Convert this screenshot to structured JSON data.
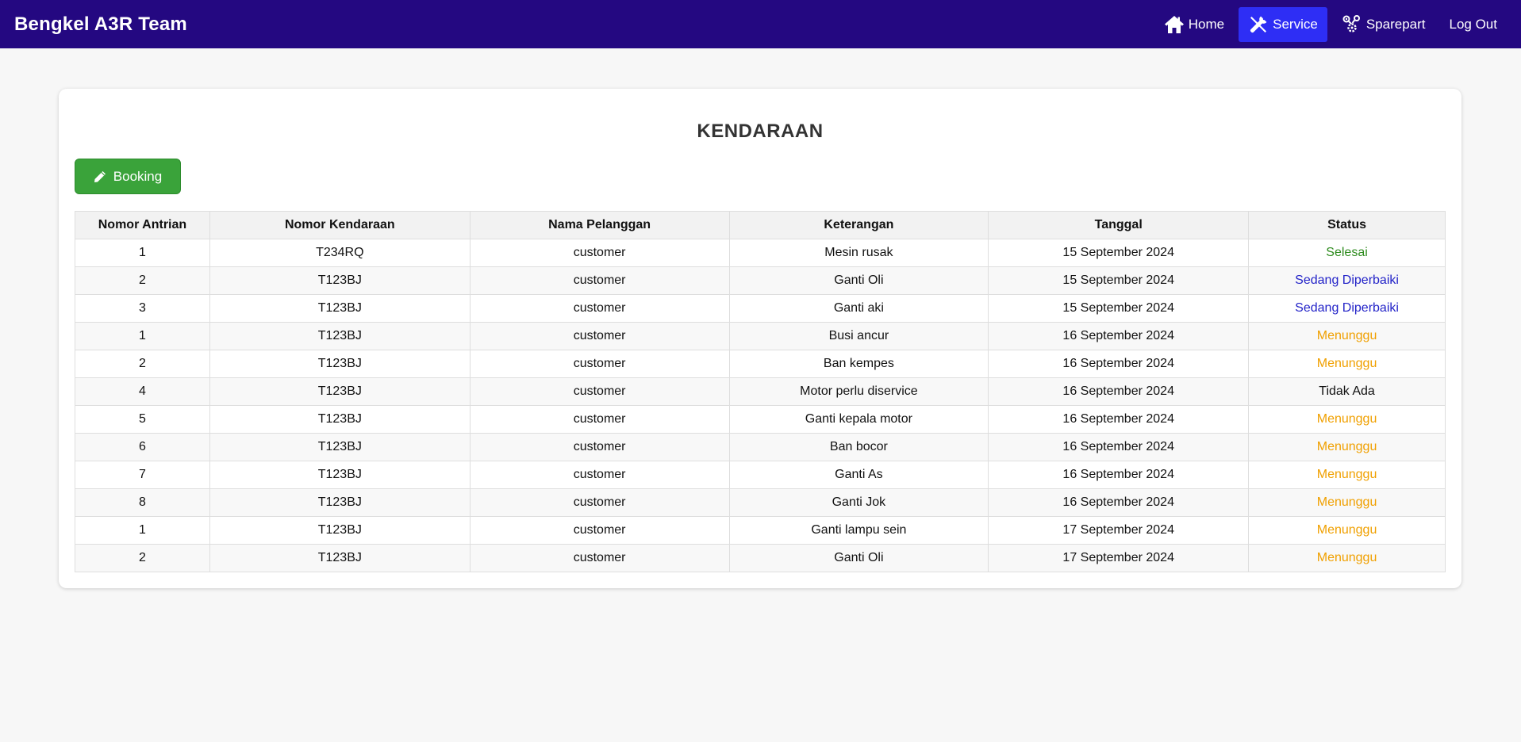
{
  "navbar": {
    "brand": "Bengkel A3R Team",
    "items": [
      {
        "label": "Home",
        "icon": "home-icon",
        "active": false
      },
      {
        "label": "Service",
        "icon": "tools-icon",
        "active": true
      },
      {
        "label": "Sparepart",
        "icon": "sparepart-icon",
        "active": false
      },
      {
        "label": "Log Out",
        "icon": "",
        "active": false
      }
    ],
    "colors": {
      "background": "#240881",
      "active": "#2e2ef5"
    }
  },
  "main": {
    "title": "KENDARAAN",
    "booking_label": "Booking",
    "booking_icon": "pencil-icon",
    "table": {
      "columns": [
        "Nomor Antrian",
        "Nomor Kendaraan",
        "Nama Pelanggan",
        "Keterangan",
        "Tanggal",
        "Status"
      ],
      "rows": [
        [
          "1",
          "T234RQ",
          "customer",
          "Mesin rusak",
          "15 September 2024",
          "Selesai"
        ],
        [
          "2",
          "T123BJ",
          "customer",
          "Ganti Oli",
          "15 September 2024",
          "Sedang Diperbaiki"
        ],
        [
          "3",
          "T123BJ",
          "customer",
          "Ganti aki",
          "15 September 2024",
          "Sedang Diperbaiki"
        ],
        [
          "1",
          "T123BJ",
          "customer",
          "Busi ancur",
          "16 September 2024",
          "Menunggu"
        ],
        [
          "2",
          "T123BJ",
          "customer",
          "Ban kempes",
          "16 September 2024",
          "Menunggu"
        ],
        [
          "4",
          "T123BJ",
          "customer",
          "Motor perlu diservice",
          "16 September 2024",
          "Tidak Ada"
        ],
        [
          "5",
          "T123BJ",
          "customer",
          "Ganti kepala motor",
          "16 September 2024",
          "Menunggu"
        ],
        [
          "6",
          "T123BJ",
          "customer",
          "Ban bocor",
          "16 September 2024",
          "Menunggu"
        ],
        [
          "7",
          "T123BJ",
          "customer",
          "Ganti As",
          "16 September 2024",
          "Menunggu"
        ],
        [
          "8",
          "T123BJ",
          "customer",
          "Ganti Jok",
          "16 September 2024",
          "Menunggu"
        ],
        [
          "1",
          "T123BJ",
          "customer",
          "Ganti lampu sein",
          "17 September 2024",
          "Menunggu"
        ],
        [
          "2",
          "T123BJ",
          "customer",
          "Ganti Oli",
          "17 September 2024",
          "Menunggu"
        ]
      ]
    },
    "status_colors": {
      "Selesai": "#2e8b1e",
      "Sedang Diperbaiki": "#2323c8",
      "Menunggu": "#f0a000",
      "Tidak Ada": "#111111"
    }
  }
}
